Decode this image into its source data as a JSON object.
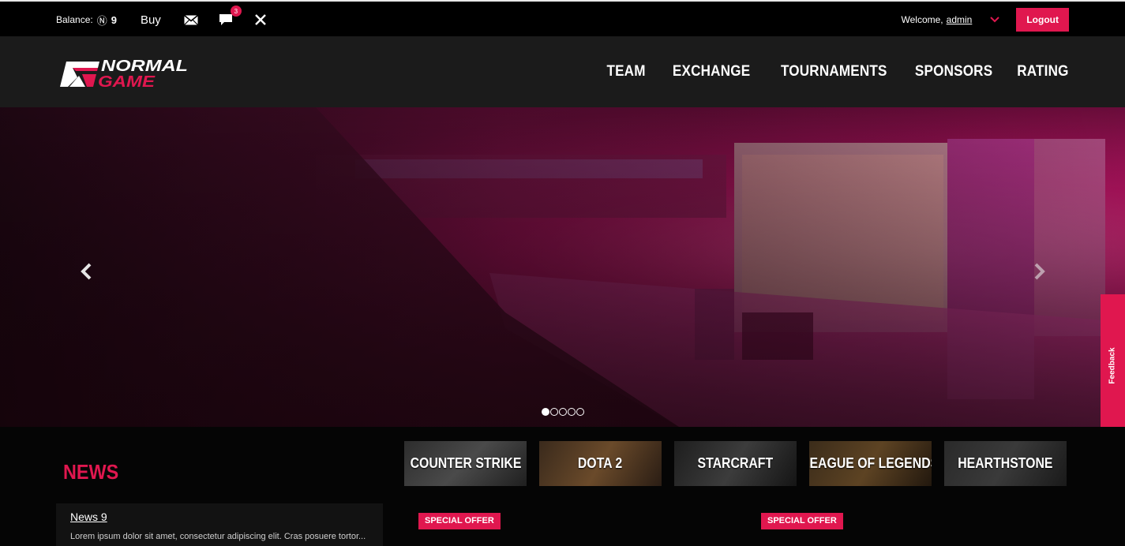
{
  "topbar": {
    "balance_label": "Balance:",
    "balance_currency_symbol": "Ⓝ",
    "balance_amount": "9",
    "buy_label": "Buy",
    "chat_badge_count": "3",
    "welcome_label": "Welcome,",
    "username": "admin",
    "logout_label": "Logout"
  },
  "logo": {
    "line1": "NORMAL",
    "line2": "GAME"
  },
  "nav": {
    "items": [
      {
        "label": "TEAM"
      },
      {
        "label": "EXCHANGE"
      },
      {
        "label": "TOURNAMENTS"
      },
      {
        "label": "SPONSORS"
      },
      {
        "label": "RATING"
      }
    ]
  },
  "hero": {
    "slide_count": 5,
    "active_slide": 1,
    "feedback_label": "Feedback"
  },
  "news": {
    "title": "NEWS",
    "items": [
      {
        "title": "News 9",
        "excerpt": "Lorem ipsum dolor sit amet, consectetur adipiscing elit. Cras posuere tortor..."
      }
    ]
  },
  "games": [
    {
      "label": "COUNTER STRIKE"
    },
    {
      "label": "DOTA 2"
    },
    {
      "label": "STARCRAFT"
    },
    {
      "label": "LEAGUE OF LEGENDS"
    },
    {
      "label": "HEARTHSTONE"
    }
  ],
  "offers": [
    {
      "label": "SPECIAL OFFER"
    },
    {
      "label": "SPECIAL OFFER"
    }
  ],
  "colors": {
    "accent": "#e0174f",
    "topbar": "#000000",
    "header": "#1b1b1b"
  }
}
